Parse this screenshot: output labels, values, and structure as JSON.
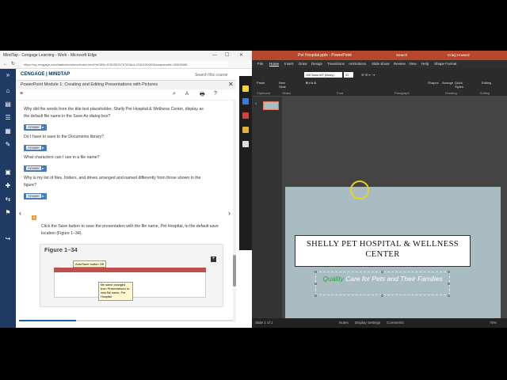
{
  "edge": {
    "title": "MindTap - Cengage Learning - Work - Microsoft Edge",
    "url": "https://ng.cengage.com/static/nb/ui/evo/index.html?eISBN=9780357676752&id=1340190053&snapshotId=26909488",
    "min": "—",
    "max": "☐",
    "close": "✕"
  },
  "mindtap": {
    "logo": "CENGAGE | MINDTAP",
    "search_placeholder": "Search this course",
    "subtitle": "PowerPoint Module 1: Creating and Editing Presentations with Pictures",
    "close": "✕",
    "toolbar_icons": [
      "≡",
      "⌕",
      "A",
      "🖶",
      "?"
    ],
    "questions": [
      "Why did the words from the title text placeholder, Shelly Pet Hospital & Wellness Center, display as the default file name in the Save As dialog box?",
      "Do I have to save to the Documents library?",
      "What characters can I use in a file name?",
      "Why is my list of files, folders, and drives arranged and named differently from those shown in the figure?"
    ],
    "answer_label": "Answer",
    "step": "Click the Save button to save the presentation with the file name, Pet Hospital, to the default save location (Figure 1–34).",
    "figure_label": "Figure 1–34",
    "callout_autosave": "AutoSave button Off",
    "callout_filename": "file name changed from Presentation1 to new file name, Pet Hospital",
    "nav_prev": "‹",
    "nav_next": "›"
  },
  "rail_icons": [
    "»",
    "⌂",
    "▤",
    "☰",
    "▦",
    "✎",
    "▣",
    "✚",
    "⇆",
    "⚑",
    "↪"
  ],
  "ppt": {
    "title": "Pet Hospital.pptx  -  PowerPoint",
    "search": "Search",
    "user": "Craig Howard",
    "tabs": [
      "File",
      "Home",
      "Insert",
      "Draw",
      "Design",
      "Transitions",
      "Animations",
      "Slide Show",
      "Review",
      "View",
      "Help",
      "Shape Format"
    ],
    "font_name": "Gill Sans MT (Body)",
    "font_size": "32",
    "groups": [
      "Clipboard",
      "Slides",
      "Font",
      "Paragraph",
      "Drawing",
      "Editing"
    ],
    "buttons": [
      "Paste",
      "New Slide",
      "Shapes",
      "Arrange",
      "Quick Styles",
      "Editing"
    ],
    "thumb_number": "1",
    "slide_title": "SHELLY PET HOSPITAL & WELLNESS CENTER",
    "slide_subtitle_green": "Quality",
    "slide_subtitle_rest": " Care for Pets and Their Families",
    "status_slide": "Slide 1 of 1",
    "status_notes": "Notes",
    "status_display": "Display Settings",
    "status_comments": "Comments",
    "status_zoom": "76%"
  },
  "colors": {
    "ppt_accent": "#b7472a",
    "mindtap_nav": "#1f3a63",
    "slide_bg": "#a8bcc2",
    "subtitle_green": "#2ea043"
  }
}
